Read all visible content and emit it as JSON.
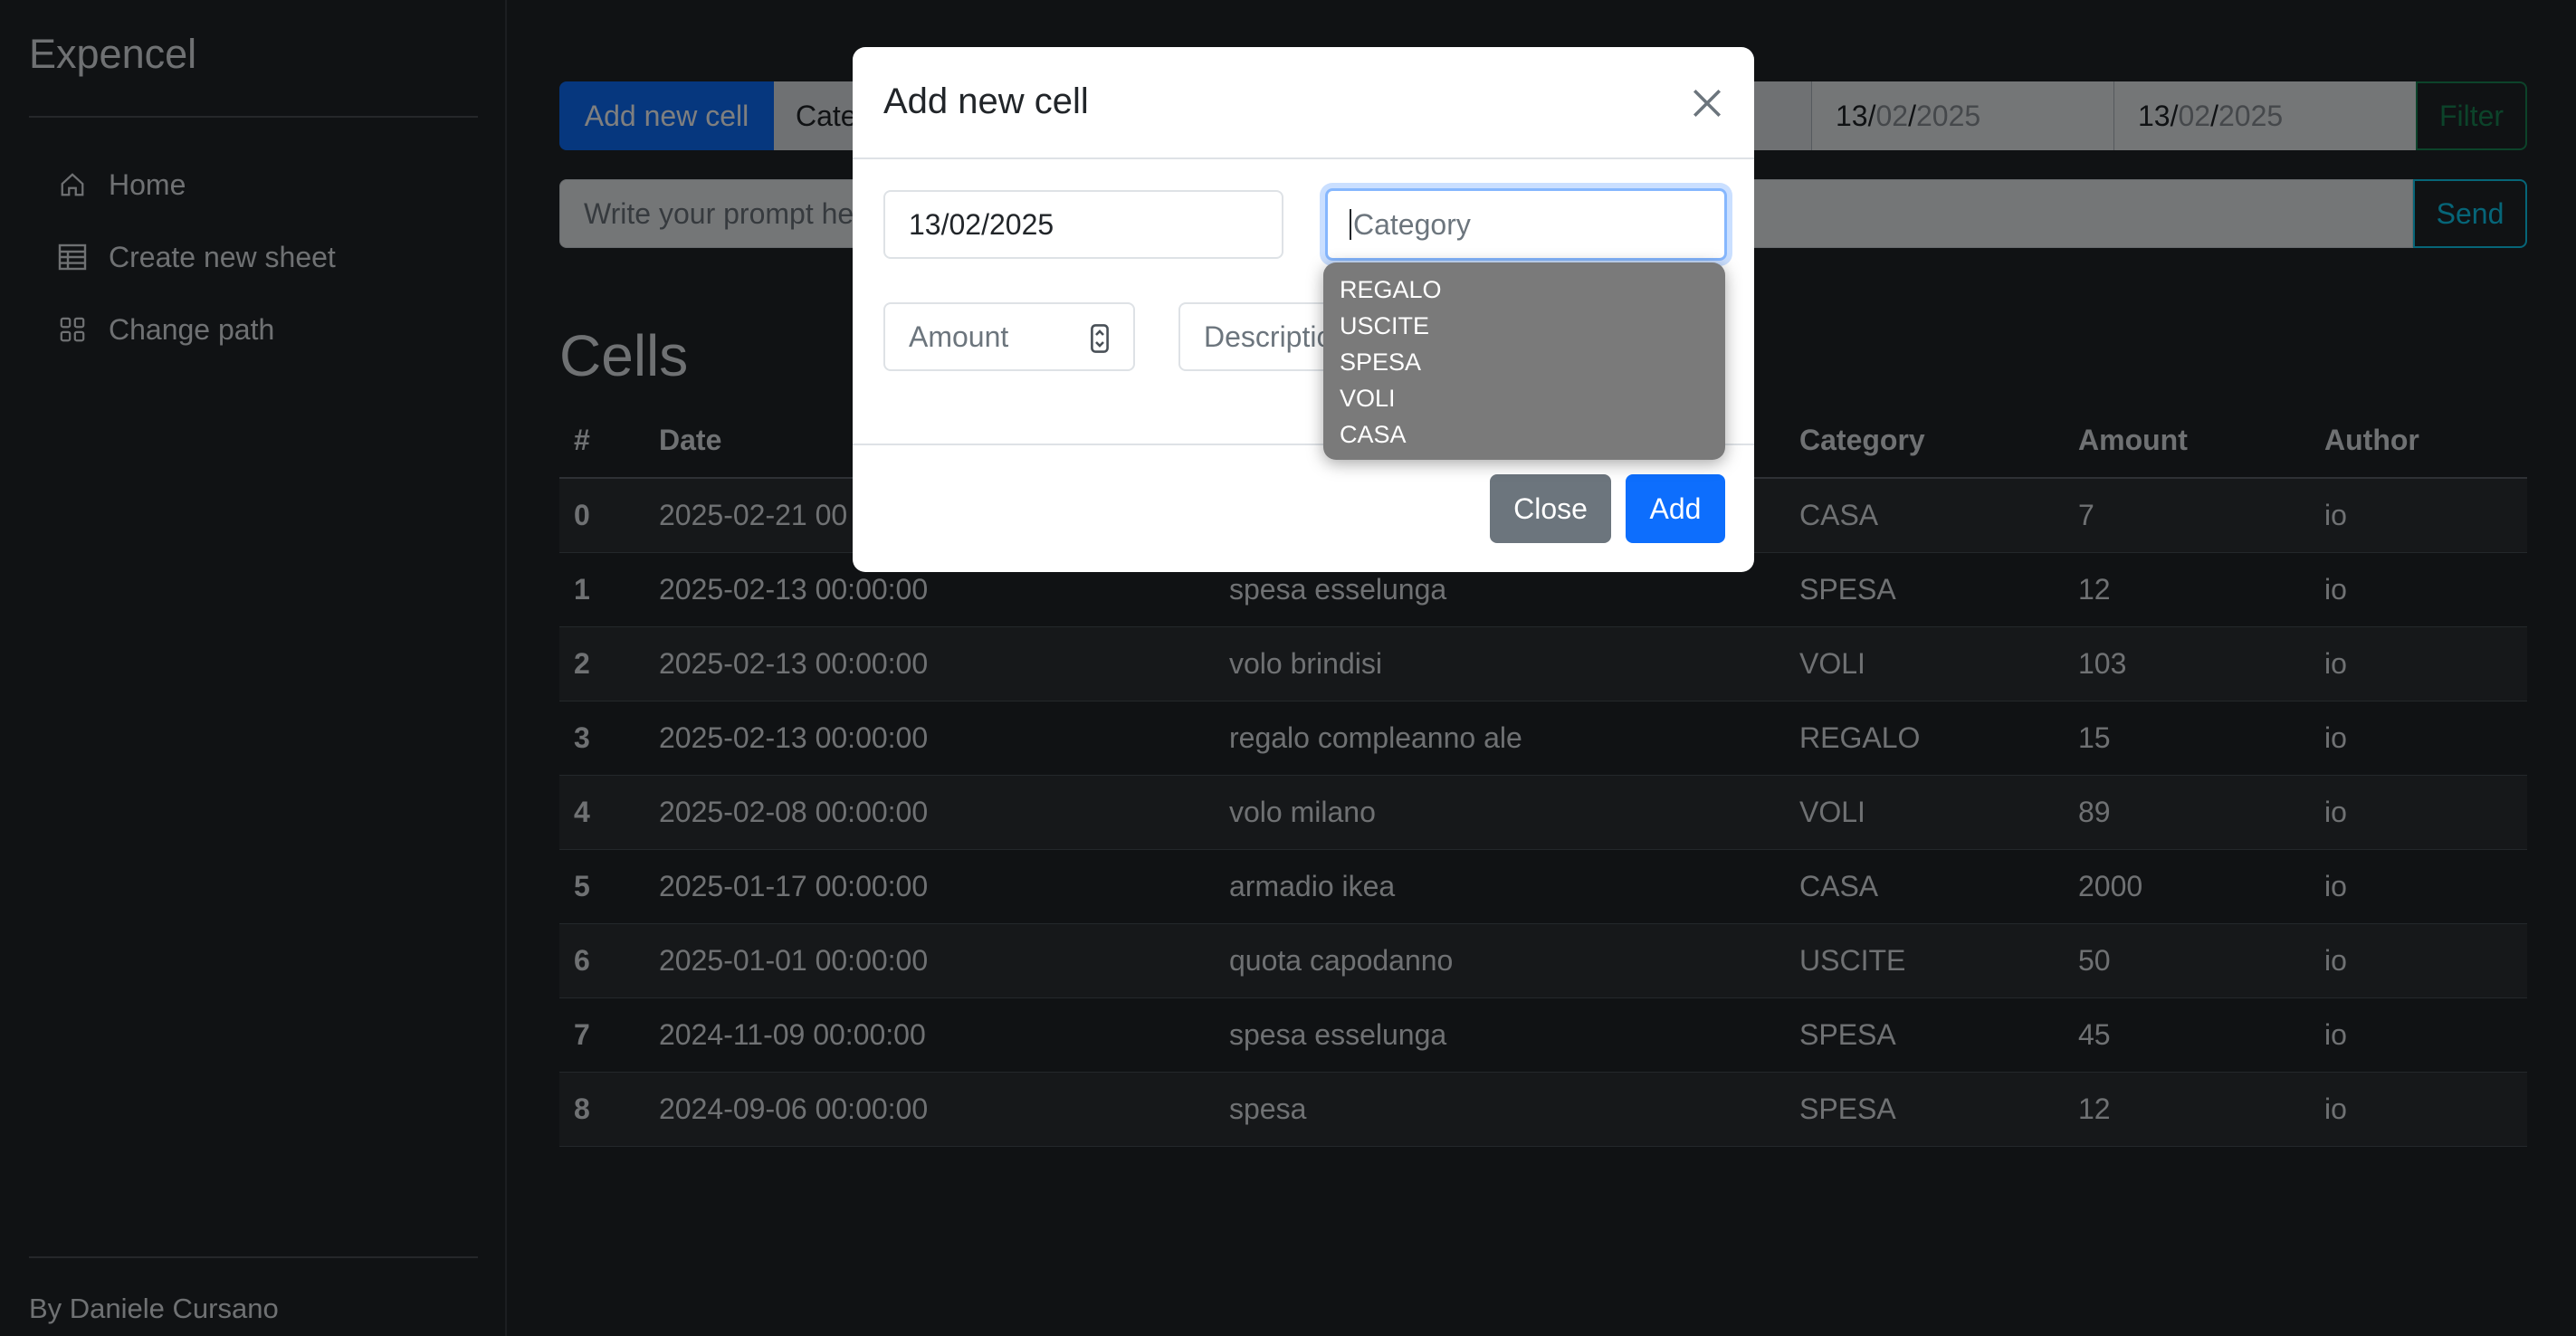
{
  "app": {
    "brand": "Expencel",
    "footer": "By Daniele Cursano"
  },
  "sidebar": {
    "items": [
      {
        "label": "Home",
        "icon": "home-icon"
      },
      {
        "label": "Create new sheet",
        "icon": "table-icon"
      },
      {
        "label": "Change path",
        "icon": "grid-icon"
      }
    ]
  },
  "toolbar": {
    "add_new_label": "Add new cell",
    "category_select": "Cate",
    "date_from": {
      "d": "13",
      "m": "02",
      "y": "2025"
    },
    "date_to": {
      "d": "13",
      "m": "02",
      "y": "2025"
    },
    "filter_label": "Filter"
  },
  "prompt": {
    "placeholder": "Write your prompt he",
    "send_label": "Send"
  },
  "cells": {
    "title": "Cells",
    "headers": [
      "#",
      "Date",
      "",
      "Category",
      "Amount",
      "Author"
    ],
    "rows": [
      {
        "idx": "0",
        "date": "2025-02-21 00",
        "desc": "",
        "cat": "CASA",
        "amount": "7",
        "author": "io"
      },
      {
        "idx": "1",
        "date": "2025-02-13 00:00:00",
        "desc": "spesa esselunga",
        "cat": "SPESA",
        "amount": "12",
        "author": "io"
      },
      {
        "idx": "2",
        "date": "2025-02-13 00:00:00",
        "desc": "volo brindisi",
        "cat": "VOLI",
        "amount": "103",
        "author": "io"
      },
      {
        "idx": "3",
        "date": "2025-02-13 00:00:00",
        "desc": "regalo compleanno ale",
        "cat": "REGALO",
        "amount": "15",
        "author": "io"
      },
      {
        "idx": "4",
        "date": "2025-02-08 00:00:00",
        "desc": "volo milano",
        "cat": "VOLI",
        "amount": "89",
        "author": "io"
      },
      {
        "idx": "5",
        "date": "2025-01-17 00:00:00",
        "desc": "armadio ikea",
        "cat": "CASA",
        "amount": "2000",
        "author": "io"
      },
      {
        "idx": "6",
        "date": "2025-01-01 00:00:00",
        "desc": "quota capodanno",
        "cat": "USCITE",
        "amount": "50",
        "author": "io"
      },
      {
        "idx": "7",
        "date": "2024-11-09 00:00:00",
        "desc": "spesa esselunga",
        "cat": "SPESA",
        "amount": "45",
        "author": "io"
      },
      {
        "idx": "8",
        "date": "2024-09-06 00:00:00",
        "desc": "spesa",
        "cat": "SPESA",
        "amount": "12",
        "author": "io"
      }
    ]
  },
  "modal": {
    "title": "Add new cell",
    "date_value": "13/02/2025",
    "category_placeholder": "Category",
    "amount_placeholder": "Amount",
    "description_placeholder": "Descriptio",
    "close_label": "Close",
    "add_label": "Add",
    "category_options": [
      "REGALO",
      "USCITE",
      "SPESA",
      "VOLI",
      "CASA"
    ]
  },
  "colors": {
    "primary": "#0d6efd",
    "success": "#198754",
    "info": "#0dcaf0",
    "secondary": "#6c757d",
    "background": "#212529"
  }
}
